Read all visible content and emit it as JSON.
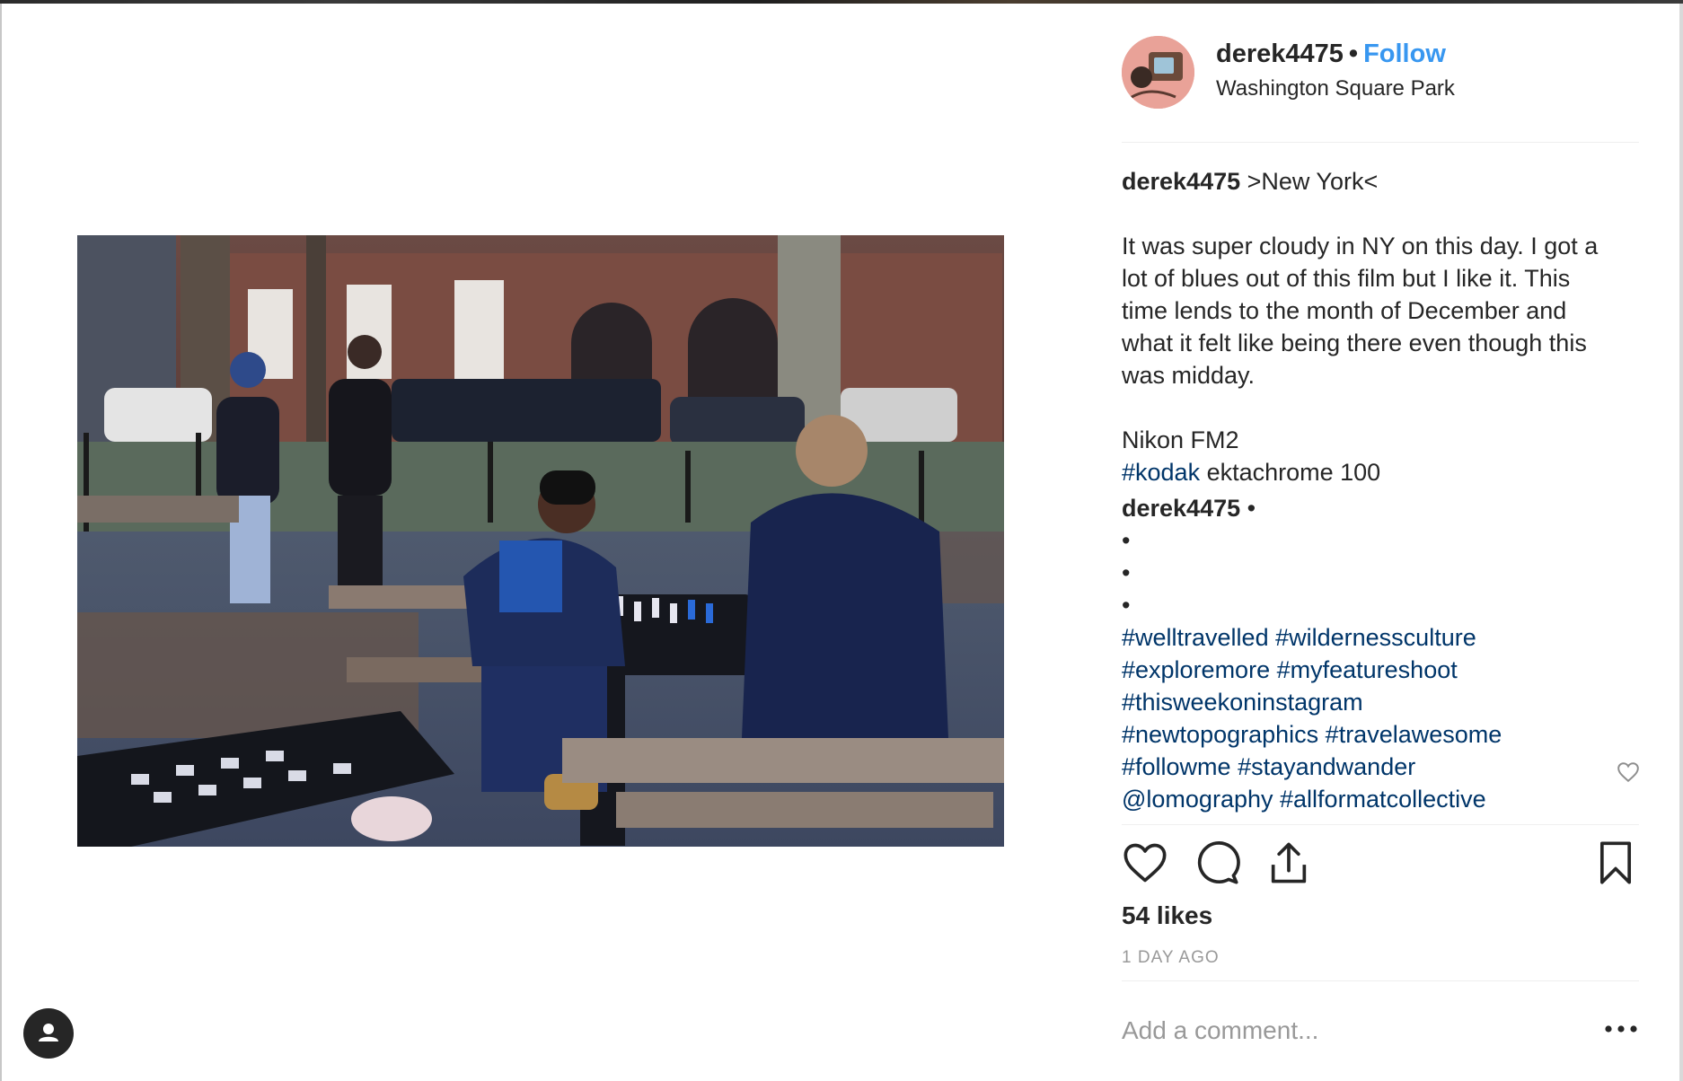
{
  "post": {
    "username": "derek4475",
    "follow_label": "Follow",
    "location": "Washington Square Park",
    "caption": {
      "username": "derek4475",
      "title": ">New York<",
      "paragraph_lines": [
        "It was super cloudy in NY on this day. I got a",
        "lot of blues out of this film but I like it. This",
        "time lends to the month of December and",
        "what it felt like being there even though this",
        "was midday."
      ],
      "camera": "Nikon FM2",
      "film_tag": "#kodak",
      "film_text": " ektachrome 100"
    },
    "comment": {
      "username": "derek4475",
      "bullet": "•",
      "hashtag_lines": [
        [
          "#welltravelled",
          "#wildernessculture"
        ],
        [
          "#exploremore",
          "#myfeatureshoot"
        ],
        [
          "#thisweekoninstagram"
        ],
        [
          "#newtopographics",
          "#travelawesome"
        ],
        [
          "#followme",
          "#stayandwander"
        ],
        [
          "@lomography",
          "#allformatcollective"
        ]
      ]
    },
    "likes": "54 likes",
    "time": "1 DAY AGO",
    "comment_placeholder": "Add a comment..."
  },
  "icons": {
    "like": "heart-icon",
    "comment": "speech-bubble-icon",
    "share": "share-icon",
    "save": "bookmark-icon",
    "more": "ellipsis-icon",
    "account": "user-icon"
  },
  "colors": {
    "follow": "#3897f0",
    "hashtag": "#003569",
    "muted": "#999999"
  }
}
